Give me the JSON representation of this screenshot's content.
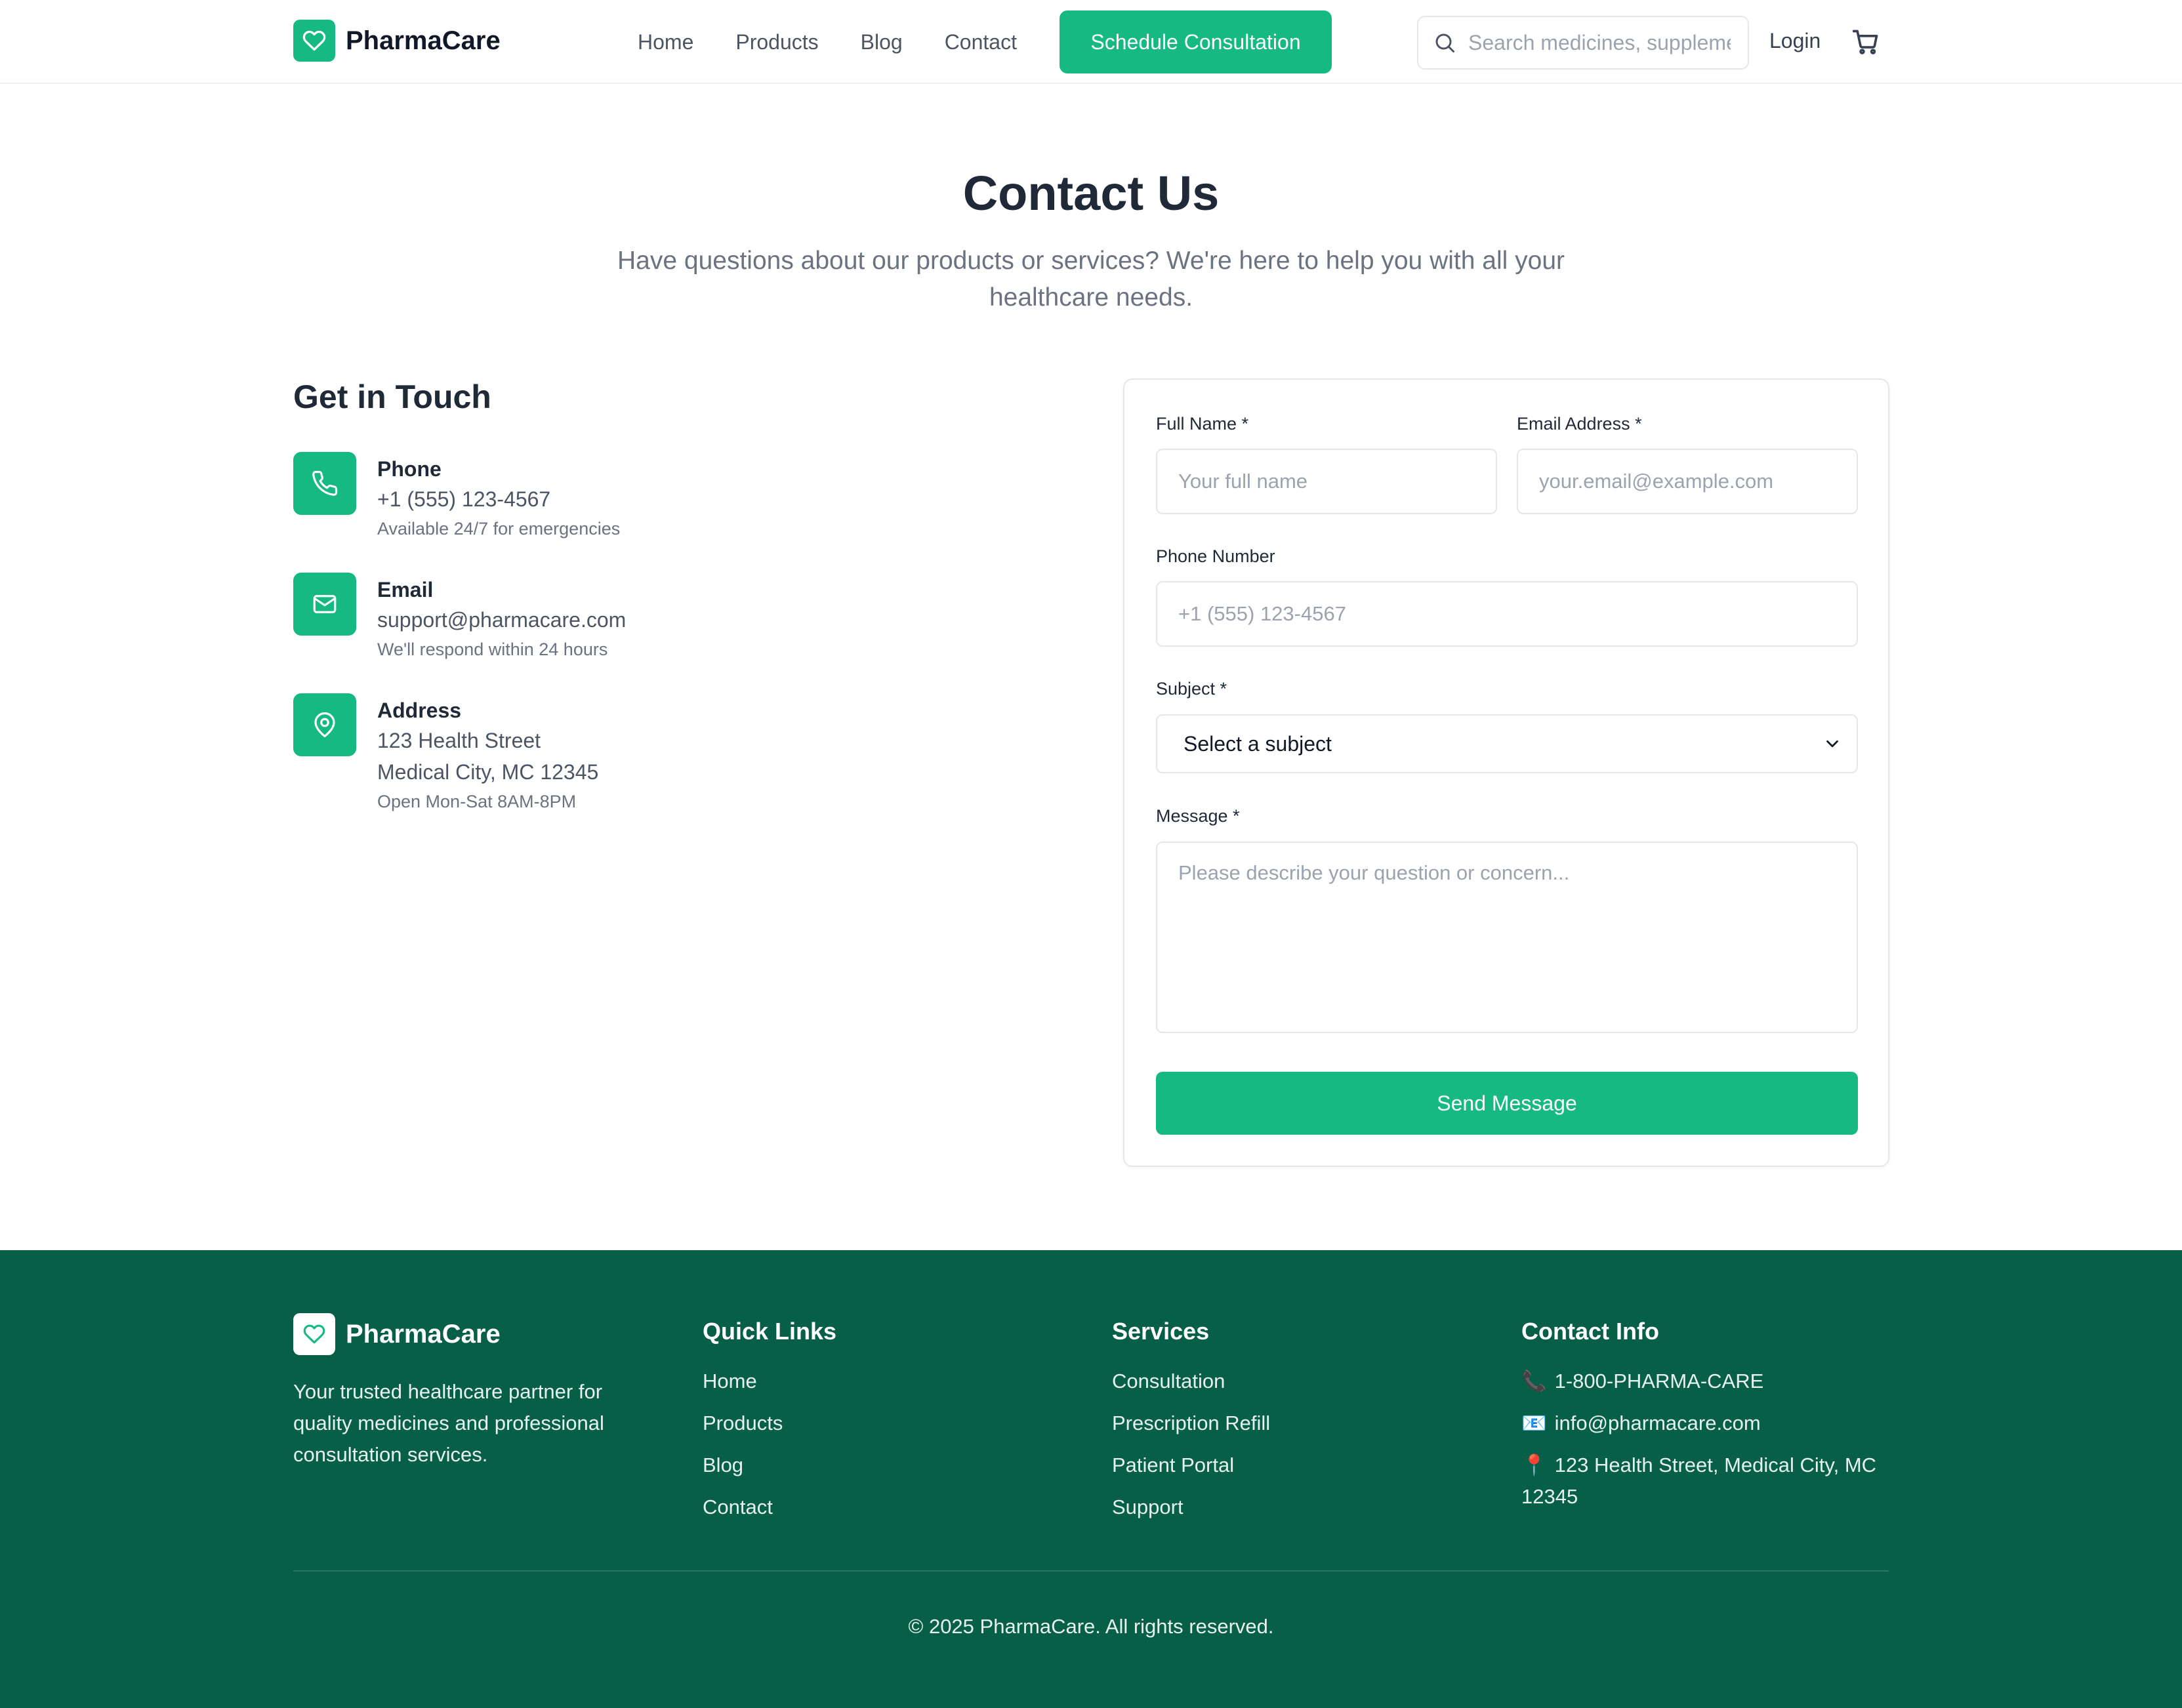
{
  "brand": {
    "name": "PharmaCare",
    "accent": "#16b981",
    "footer_bg": "#085f48"
  },
  "nav": {
    "items": [
      {
        "label": "Home"
      },
      {
        "label": "Products"
      },
      {
        "label": "Blog"
      },
      {
        "label": "Contact"
      }
    ],
    "cta_label": "Schedule Consultation",
    "search_placeholder": "Search medicines, supplements...",
    "login_label": "Login",
    "cart_icon": "cart-icon"
  },
  "hero": {
    "title": "Contact Us",
    "subtitle": "Have questions about our products or services? We're here to help you with all your healthcare needs."
  },
  "get_in_touch": {
    "title": "Get in Touch",
    "items": [
      {
        "icon": "phone-icon",
        "label": "Phone",
        "lines": [
          "+1 (555) 123-4567"
        ],
        "note": "Available 24/7 for emergencies"
      },
      {
        "icon": "mail-icon",
        "label": "Email",
        "lines": [
          "support@pharmacare.com"
        ],
        "note": "We'll respond within 24 hours"
      },
      {
        "icon": "map-pin-icon",
        "label": "Address",
        "lines": [
          "123 Health Street",
          "Medical City, MC 12345"
        ],
        "note": "Open Mon-Sat 8AM-8PM"
      }
    ]
  },
  "form": {
    "full_name": {
      "label": "Full Name *",
      "placeholder": "Your full name",
      "value": ""
    },
    "email": {
      "label": "Email Address *",
      "placeholder": "your.email@example.com",
      "value": ""
    },
    "phone": {
      "label": "Phone Number",
      "placeholder": "+1 (555) 123-4567",
      "value": ""
    },
    "subject": {
      "label": "Subject *",
      "selected": "Select a subject"
    },
    "message": {
      "label": "Message *",
      "placeholder": "Please describe your question or concern...",
      "value": ""
    },
    "submit_label": "Send Message"
  },
  "footer": {
    "brand": "PharmaCare",
    "description": "Your trusted healthcare partner for quality medicines and professional consultation services.",
    "quick_links": {
      "title": "Quick Links",
      "items": [
        "Home",
        "Products",
        "Blog",
        "Contact"
      ]
    },
    "services": {
      "title": "Services",
      "items": [
        "Consultation",
        "Prescription Refill",
        "Patient Portal",
        "Support"
      ]
    },
    "contact_info": {
      "title": "Contact Info",
      "items": [
        {
          "emoji": "📞",
          "text": "1-800-PHARMA-CARE"
        },
        {
          "emoji": "📧",
          "text": "info@pharmacare.com"
        },
        {
          "emoji": "📍",
          "text": "123 Health Street, Medical City, MC 12345"
        }
      ]
    },
    "copyright": "© 2025 PharmaCare. All rights reserved."
  }
}
